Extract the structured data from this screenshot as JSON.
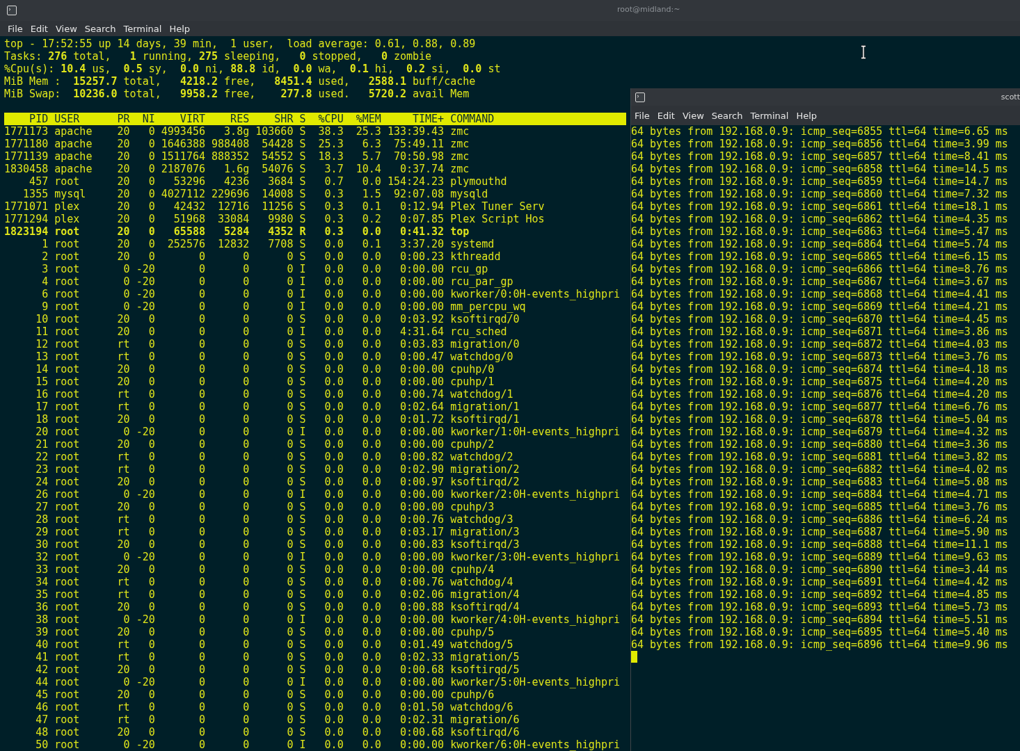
{
  "main_window": {
    "title": "root@midland:~",
    "menu": [
      "File",
      "Edit",
      "View",
      "Search",
      "Terminal",
      "Help"
    ],
    "summary": [
      "top - 17:52:55 up 14 days, 39 min,  1 user,  load average: 0.61, 0.88, 0.89",
      "Tasks: **276** total,   **1** running, **275** sleeping,   **0** stopped,   **0** zombie",
      "%Cpu(s): **10.4** us,  **0.5** sy,  **0.0** ni, **88.8** id,  **0.0** wa,  **0.1** hi,  **0.2** si,  **0.0** st",
      "MiB Mem :  **15257.7** total,   **4218.2** free,   **8451.4** used,   **2588.1** buff/cache",
      "MiB Swap:  **10236.0** total,   **9958.2** free,    **277.8** used.   **5720.2** avail Mem"
    ],
    "columns": [
      "PID",
      "USER",
      "PR",
      "NI",
      "VIRT",
      "RES",
      "SHR",
      "S",
      "%CPU",
      "%MEM",
      "TIME+",
      "COMMAND"
    ],
    "rows": [
      {
        "bold": false,
        "cells": [
          "1771173",
          "apache",
          "20",
          "0",
          "4993456",
          "3.8g",
          "103660",
          "S",
          "38.3",
          "25.3",
          "133:39.43",
          "zmc"
        ]
      },
      {
        "bold": false,
        "cells": [
          "1771180",
          "apache",
          "20",
          "0",
          "1646388",
          "988408",
          "54428",
          "S",
          "25.3",
          "6.3",
          "75:49.11",
          "zmc"
        ]
      },
      {
        "bold": false,
        "cells": [
          "1771139",
          "apache",
          "20",
          "0",
          "1511764",
          "888352",
          "54552",
          "S",
          "18.3",
          "5.7",
          "70:50.98",
          "zmc"
        ]
      },
      {
        "bold": false,
        "cells": [
          "1830458",
          "apache",
          "20",
          "0",
          "2187076",
          "1.6g",
          "54076",
          "S",
          "3.7",
          "10.4",
          "0:37.74",
          "zmc"
        ]
      },
      {
        "bold": false,
        "cells": [
          "457",
          "root",
          "20",
          "0",
          "53296",
          "4236",
          "3684",
          "S",
          "0.7",
          "0.0",
          "154:24.23",
          "plymouthd"
        ]
      },
      {
        "bold": false,
        "cells": [
          "1355",
          "mysql",
          "20",
          "0",
          "4027112",
          "229696",
          "14008",
          "S",
          "0.3",
          "1.5",
          "92:07.08",
          "mysqld"
        ]
      },
      {
        "bold": false,
        "cells": [
          "1771071",
          "plex",
          "20",
          "0",
          "42432",
          "12716",
          "11256",
          "S",
          "0.3",
          "0.1",
          "0:12.94",
          "Plex Tuner Serv"
        ]
      },
      {
        "bold": false,
        "cells": [
          "1771294",
          "plex",
          "20",
          "0",
          "51968",
          "33084",
          "9980",
          "S",
          "0.3",
          "0.2",
          "0:07.85",
          "Plex Script Hos"
        ]
      },
      {
        "bold": true,
        "cells": [
          "1823194",
          "root",
          "20",
          "0",
          "65588",
          "5284",
          "4352",
          "R",
          "0.3",
          "0.0",
          "0:41.32",
          "top"
        ]
      },
      {
        "bold": false,
        "cells": [
          "1",
          "root",
          "20",
          "0",
          "252576",
          "12832",
          "7708",
          "S",
          "0.0",
          "0.1",
          "3:37.20",
          "systemd"
        ]
      },
      {
        "bold": false,
        "cells": [
          "2",
          "root",
          "20",
          "0",
          "0",
          "0",
          "0",
          "S",
          "0.0",
          "0.0",
          "0:00.23",
          "kthreadd"
        ]
      },
      {
        "bold": false,
        "cells": [
          "3",
          "root",
          "0",
          "-20",
          "0",
          "0",
          "0",
          "I",
          "0.0",
          "0.0",
          "0:00.00",
          "rcu_gp"
        ]
      },
      {
        "bold": false,
        "cells": [
          "4",
          "root",
          "0",
          "-20",
          "0",
          "0",
          "0",
          "I",
          "0.0",
          "0.0",
          "0:00.00",
          "rcu_par_gp"
        ]
      },
      {
        "bold": false,
        "cells": [
          "6",
          "root",
          "0",
          "-20",
          "0",
          "0",
          "0",
          "I",
          "0.0",
          "0.0",
          "0:00.00",
          "kworker/0:0H-events_highpri"
        ]
      },
      {
        "bold": false,
        "cells": [
          "9",
          "root",
          "0",
          "-20",
          "0",
          "0",
          "0",
          "I",
          "0.0",
          "0.0",
          "0:00.00",
          "mm_percpu_wq"
        ]
      },
      {
        "bold": false,
        "cells": [
          "10",
          "root",
          "20",
          "0",
          "0",
          "0",
          "0",
          "S",
          "0.0",
          "0.0",
          "0:03.92",
          "ksoftirqd/0"
        ]
      },
      {
        "bold": false,
        "cells": [
          "11",
          "root",
          "20",
          "0",
          "0",
          "0",
          "0",
          "I",
          "0.0",
          "0.0",
          "4:31.64",
          "rcu_sched"
        ]
      },
      {
        "bold": false,
        "cells": [
          "12",
          "root",
          "rt",
          "0",
          "0",
          "0",
          "0",
          "S",
          "0.0",
          "0.0",
          "0:03.83",
          "migration/0"
        ]
      },
      {
        "bold": false,
        "cells": [
          "13",
          "root",
          "rt",
          "0",
          "0",
          "0",
          "0",
          "S",
          "0.0",
          "0.0",
          "0:00.47",
          "watchdog/0"
        ]
      },
      {
        "bold": false,
        "cells": [
          "14",
          "root",
          "20",
          "0",
          "0",
          "0",
          "0",
          "S",
          "0.0",
          "0.0",
          "0:00.00",
          "cpuhp/0"
        ]
      },
      {
        "bold": false,
        "cells": [
          "15",
          "root",
          "20",
          "0",
          "0",
          "0",
          "0",
          "S",
          "0.0",
          "0.0",
          "0:00.00",
          "cpuhp/1"
        ]
      },
      {
        "bold": false,
        "cells": [
          "16",
          "root",
          "rt",
          "0",
          "0",
          "0",
          "0",
          "S",
          "0.0",
          "0.0",
          "0:00.74",
          "watchdog/1"
        ]
      },
      {
        "bold": false,
        "cells": [
          "17",
          "root",
          "rt",
          "0",
          "0",
          "0",
          "0",
          "S",
          "0.0",
          "0.0",
          "0:02.64",
          "migration/1"
        ]
      },
      {
        "bold": false,
        "cells": [
          "18",
          "root",
          "20",
          "0",
          "0",
          "0",
          "0",
          "S",
          "0.0",
          "0.0",
          "0:01.72",
          "ksoftirqd/1"
        ]
      },
      {
        "bold": false,
        "cells": [
          "20",
          "root",
          "0",
          "-20",
          "0",
          "0",
          "0",
          "I",
          "0.0",
          "0.0",
          "0:00.00",
          "kworker/1:0H-events_highpri"
        ]
      },
      {
        "bold": false,
        "cells": [
          "21",
          "root",
          "20",
          "0",
          "0",
          "0",
          "0",
          "S",
          "0.0",
          "0.0",
          "0:00.00",
          "cpuhp/2"
        ]
      },
      {
        "bold": false,
        "cells": [
          "22",
          "root",
          "rt",
          "0",
          "0",
          "0",
          "0",
          "S",
          "0.0",
          "0.0",
          "0:00.82",
          "watchdog/2"
        ]
      },
      {
        "bold": false,
        "cells": [
          "23",
          "root",
          "rt",
          "0",
          "0",
          "0",
          "0",
          "S",
          "0.0",
          "0.0",
          "0:02.90",
          "migration/2"
        ]
      },
      {
        "bold": false,
        "cells": [
          "24",
          "root",
          "20",
          "0",
          "0",
          "0",
          "0",
          "S",
          "0.0",
          "0.0",
          "0:00.97",
          "ksoftirqd/2"
        ]
      },
      {
        "bold": false,
        "cells": [
          "26",
          "root",
          "0",
          "-20",
          "0",
          "0",
          "0",
          "I",
          "0.0",
          "0.0",
          "0:00.00",
          "kworker/2:0H-events_highpri"
        ]
      },
      {
        "bold": false,
        "cells": [
          "27",
          "root",
          "20",
          "0",
          "0",
          "0",
          "0",
          "S",
          "0.0",
          "0.0",
          "0:00.00",
          "cpuhp/3"
        ]
      },
      {
        "bold": false,
        "cells": [
          "28",
          "root",
          "rt",
          "0",
          "0",
          "0",
          "0",
          "S",
          "0.0",
          "0.0",
          "0:00.76",
          "watchdog/3"
        ]
      },
      {
        "bold": false,
        "cells": [
          "29",
          "root",
          "rt",
          "0",
          "0",
          "0",
          "0",
          "S",
          "0.0",
          "0.0",
          "0:03.17",
          "migration/3"
        ]
      },
      {
        "bold": false,
        "cells": [
          "30",
          "root",
          "20",
          "0",
          "0",
          "0",
          "0",
          "S",
          "0.0",
          "0.0",
          "0:00.83",
          "ksoftirqd/3"
        ]
      },
      {
        "bold": false,
        "cells": [
          "32",
          "root",
          "0",
          "-20",
          "0",
          "0",
          "0",
          "I",
          "0.0",
          "0.0",
          "0:00.00",
          "kworker/3:0H-events_highpri"
        ]
      },
      {
        "bold": false,
        "cells": [
          "33",
          "root",
          "20",
          "0",
          "0",
          "0",
          "0",
          "S",
          "0.0",
          "0.0",
          "0:00.00",
          "cpuhp/4"
        ]
      },
      {
        "bold": false,
        "cells": [
          "34",
          "root",
          "rt",
          "0",
          "0",
          "0",
          "0",
          "S",
          "0.0",
          "0.0",
          "0:00.76",
          "watchdog/4"
        ]
      },
      {
        "bold": false,
        "cells": [
          "35",
          "root",
          "rt",
          "0",
          "0",
          "0",
          "0",
          "S",
          "0.0",
          "0.0",
          "0:02.06",
          "migration/4"
        ]
      },
      {
        "bold": false,
        "cells": [
          "36",
          "root",
          "20",
          "0",
          "0",
          "0",
          "0",
          "S",
          "0.0",
          "0.0",
          "0:00.88",
          "ksoftirqd/4"
        ]
      },
      {
        "bold": false,
        "cells": [
          "38",
          "root",
          "0",
          "-20",
          "0",
          "0",
          "0",
          "I",
          "0.0",
          "0.0",
          "0:00.00",
          "kworker/4:0H-events_highpri"
        ]
      },
      {
        "bold": false,
        "cells": [
          "39",
          "root",
          "20",
          "0",
          "0",
          "0",
          "0",
          "S",
          "0.0",
          "0.0",
          "0:00.00",
          "cpuhp/5"
        ]
      },
      {
        "bold": false,
        "cells": [
          "40",
          "root",
          "rt",
          "0",
          "0",
          "0",
          "0",
          "S",
          "0.0",
          "0.0",
          "0:01.49",
          "watchdog/5"
        ]
      },
      {
        "bold": false,
        "cells": [
          "41",
          "root",
          "rt",
          "0",
          "0",
          "0",
          "0",
          "S",
          "0.0",
          "0.0",
          "0:02.33",
          "migration/5"
        ]
      },
      {
        "bold": false,
        "cells": [
          "42",
          "root",
          "20",
          "0",
          "0",
          "0",
          "0",
          "S",
          "0.0",
          "0.0",
          "0:00.68",
          "ksoftirqd/5"
        ]
      },
      {
        "bold": false,
        "cells": [
          "44",
          "root",
          "0",
          "-20",
          "0",
          "0",
          "0",
          "I",
          "0.0",
          "0.0",
          "0:00.00",
          "kworker/5:0H-events_highpri"
        ]
      },
      {
        "bold": false,
        "cells": [
          "45",
          "root",
          "20",
          "0",
          "0",
          "0",
          "0",
          "S",
          "0.0",
          "0.0",
          "0:00.00",
          "cpuhp/6"
        ]
      },
      {
        "bold": false,
        "cells": [
          "46",
          "root",
          "rt",
          "0",
          "0",
          "0",
          "0",
          "S",
          "0.0",
          "0.0",
          "0:01.50",
          "watchdog/6"
        ]
      },
      {
        "bold": false,
        "cells": [
          "47",
          "root",
          "rt",
          "0",
          "0",
          "0",
          "0",
          "S",
          "0.0",
          "0.0",
          "0:02.31",
          "migration/6"
        ]
      },
      {
        "bold": false,
        "cells": [
          "48",
          "root",
          "20",
          "0",
          "0",
          "0",
          "0",
          "S",
          "0.0",
          "0.0",
          "0:00.68",
          "ksoftirqd/6"
        ]
      },
      {
        "bold": false,
        "cells": [
          "50",
          "root",
          "0",
          "-20",
          "0",
          "0",
          "0",
          "I",
          "0.0",
          "0.0",
          "0:00.00",
          "kworker/6:0H-events_highpri"
        ]
      }
    ]
  },
  "second_window": {
    "title": "scott",
    "menu": [
      "File",
      "Edit",
      "View",
      "Search",
      "Terminal",
      "Help"
    ],
    "lines": [
      "64 bytes from 192.168.0.9: icmp_seq=6855 ttl=64 time=6.65 ms",
      "64 bytes from 192.168.0.9: icmp_seq=6856 ttl=64 time=3.99 ms",
      "64 bytes from 192.168.0.9: icmp_seq=6857 ttl=64 time=8.41 ms",
      "64 bytes from 192.168.0.9: icmp_seq=6858 ttl=64 time=14.5 ms",
      "64 bytes from 192.168.0.9: icmp_seq=6859 ttl=64 time=14.7 ms",
      "64 bytes from 192.168.0.9: icmp_seq=6860 ttl=64 time=7.32 ms",
      "64 bytes from 192.168.0.9: icmp_seq=6861 ttl=64 time=18.1 ms",
      "64 bytes from 192.168.0.9: icmp_seq=6862 ttl=64 time=4.35 ms",
      "64 bytes from 192.168.0.9: icmp_seq=6863 ttl=64 time=5.47 ms",
      "64 bytes from 192.168.0.9: icmp_seq=6864 ttl=64 time=5.74 ms",
      "64 bytes from 192.168.0.9: icmp_seq=6865 ttl=64 time=6.15 ms",
      "64 bytes from 192.168.0.9: icmp_seq=6866 ttl=64 time=8.76 ms",
      "64 bytes from 192.168.0.9: icmp_seq=6867 ttl=64 time=3.67 ms",
      "64 bytes from 192.168.0.9: icmp_seq=6868 ttl=64 time=4.41 ms",
      "64 bytes from 192.168.0.9: icmp_seq=6869 ttl=64 time=4.21 ms",
      "64 bytes from 192.168.0.9: icmp_seq=6870 ttl=64 time=4.45 ms",
      "64 bytes from 192.168.0.9: icmp_seq=6871 ttl=64 time=3.86 ms",
      "64 bytes from 192.168.0.9: icmp_seq=6872 ttl=64 time=4.03 ms",
      "64 bytes from 192.168.0.9: icmp_seq=6873 ttl=64 time=3.76 ms",
      "64 bytes from 192.168.0.9: icmp_seq=6874 ttl=64 time=4.18 ms",
      "64 bytes from 192.168.0.9: icmp_seq=6875 ttl=64 time=4.20 ms",
      "64 bytes from 192.168.0.9: icmp_seq=6876 ttl=64 time=4.20 ms",
      "64 bytes from 192.168.0.9: icmp_seq=6877 ttl=64 time=6.76 ms",
      "64 bytes from 192.168.0.9: icmp_seq=6878 ttl=64 time=5.04 ms",
      "64 bytes from 192.168.0.9: icmp_seq=6879 ttl=64 time=4.32 ms",
      "64 bytes from 192.168.0.9: icmp_seq=6880 ttl=64 time=3.36 ms",
      "64 bytes from 192.168.0.9: icmp_seq=6881 ttl=64 time=3.82 ms",
      "64 bytes from 192.168.0.9: icmp_seq=6882 ttl=64 time=4.02 ms",
      "64 bytes from 192.168.0.9: icmp_seq=6883 ttl=64 time=5.08 ms",
      "64 bytes from 192.168.0.9: icmp_seq=6884 ttl=64 time=4.71 ms",
      "64 bytes from 192.168.0.9: icmp_seq=6885 ttl=64 time=3.76 ms",
      "64 bytes from 192.168.0.9: icmp_seq=6886 ttl=64 time=6.24 ms",
      "64 bytes from 192.168.0.9: icmp_seq=6887 ttl=64 time=5.90 ms",
      "64 bytes from 192.168.0.9: icmp_seq=6888 ttl=64 time=11.1 ms",
      "64 bytes from 192.168.0.9: icmp_seq=6889 ttl=64 time=9.63 ms",
      "64 bytes from 192.168.0.9: icmp_seq=6890 ttl=64 time=3.44 ms",
      "64 bytes from 192.168.0.9: icmp_seq=6891 ttl=64 time=4.42 ms",
      "64 bytes from 192.168.0.9: icmp_seq=6892 ttl=64 time=4.85 ms",
      "64 bytes from 192.168.0.9: icmp_seq=6893 ttl=64 time=5.73 ms",
      "64 bytes from 192.168.0.9: icmp_seq=6894 ttl=64 time=5.51 ms",
      "64 bytes from 192.168.0.9: icmp_seq=6895 ttl=64 time=5.40 ms",
      "64 bytes from 192.168.0.9: icmp_seq=6896 ttl=64 time=9.96 ms"
    ]
  }
}
